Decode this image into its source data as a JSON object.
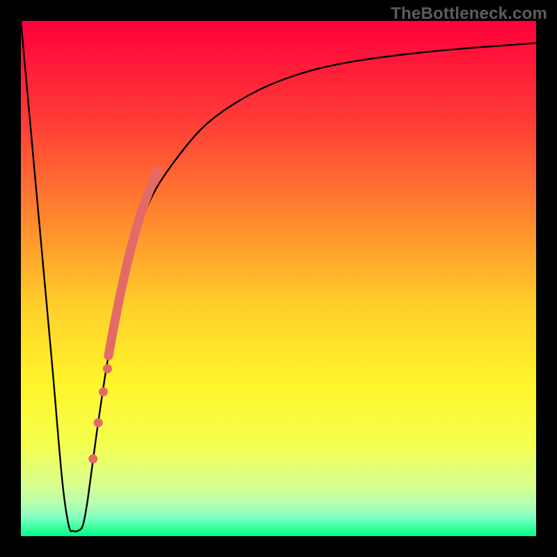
{
  "watermark": "TheBottleneck.com",
  "colors": {
    "frame": "#000000",
    "curve": "#000000",
    "marker": "#e46a68",
    "gradient_stops": [
      {
        "offset": 0.0,
        "color": "#ff003b"
      },
      {
        "offset": 0.2,
        "color": "#ff3e36"
      },
      {
        "offset": 0.4,
        "color": "#ff8f2e"
      },
      {
        "offset": 0.55,
        "color": "#ffce29"
      },
      {
        "offset": 0.7,
        "color": "#fff42a"
      },
      {
        "offset": 0.82,
        "color": "#f5ff4e"
      },
      {
        "offset": 0.9,
        "color": "#d9ff8e"
      },
      {
        "offset": 0.94,
        "color": "#b2ffb2"
      },
      {
        "offset": 0.965,
        "color": "#7dffc1"
      },
      {
        "offset": 0.985,
        "color": "#32ff9e"
      },
      {
        "offset": 1.0,
        "color": "#00ff85"
      }
    ]
  },
  "chart_data": {
    "type": "line",
    "title": "",
    "xlabel": "",
    "ylabel": "",
    "xlim": [
      0,
      100
    ],
    "ylim": [
      0,
      100
    ],
    "grid": false,
    "series": [
      {
        "name": "bottleneck-curve",
        "x": [
          0,
          3,
          6,
          8,
          9.3,
          10.2,
          11,
          12,
          12.8,
          13.5,
          15,
          17,
          20,
          23,
          26,
          30,
          35,
          40,
          46,
          52,
          58,
          65,
          72,
          80,
          88,
          96,
          100
        ],
        "y": [
          100,
          67,
          34,
          11,
          2,
          1,
          1,
          2,
          6,
          11,
          22,
          35,
          50,
          60,
          67,
          73,
          79,
          83,
          86.5,
          89,
          90.8,
          92.2,
          93.2,
          94.1,
          94.8,
          95.4,
          95.7
        ]
      }
    ],
    "highlighted_segment": {
      "name": "thick-marker-segment",
      "x": [
        17.0,
        18.1,
        19.2,
        20.3,
        21.4,
        22.5,
        23.6,
        24.7,
        25.8,
        26.5
      ],
      "y": [
        35.0,
        41.0,
        46.5,
        51.5,
        56.0,
        60.0,
        63.5,
        66.5,
        69.2,
        70.8
      ]
    },
    "marker_points": {
      "name": "discrete-marker-dots",
      "x": [
        14.0,
        15.0,
        16.0,
        16.8
      ],
      "y": [
        15,
        22,
        28,
        32.5
      ]
    }
  }
}
